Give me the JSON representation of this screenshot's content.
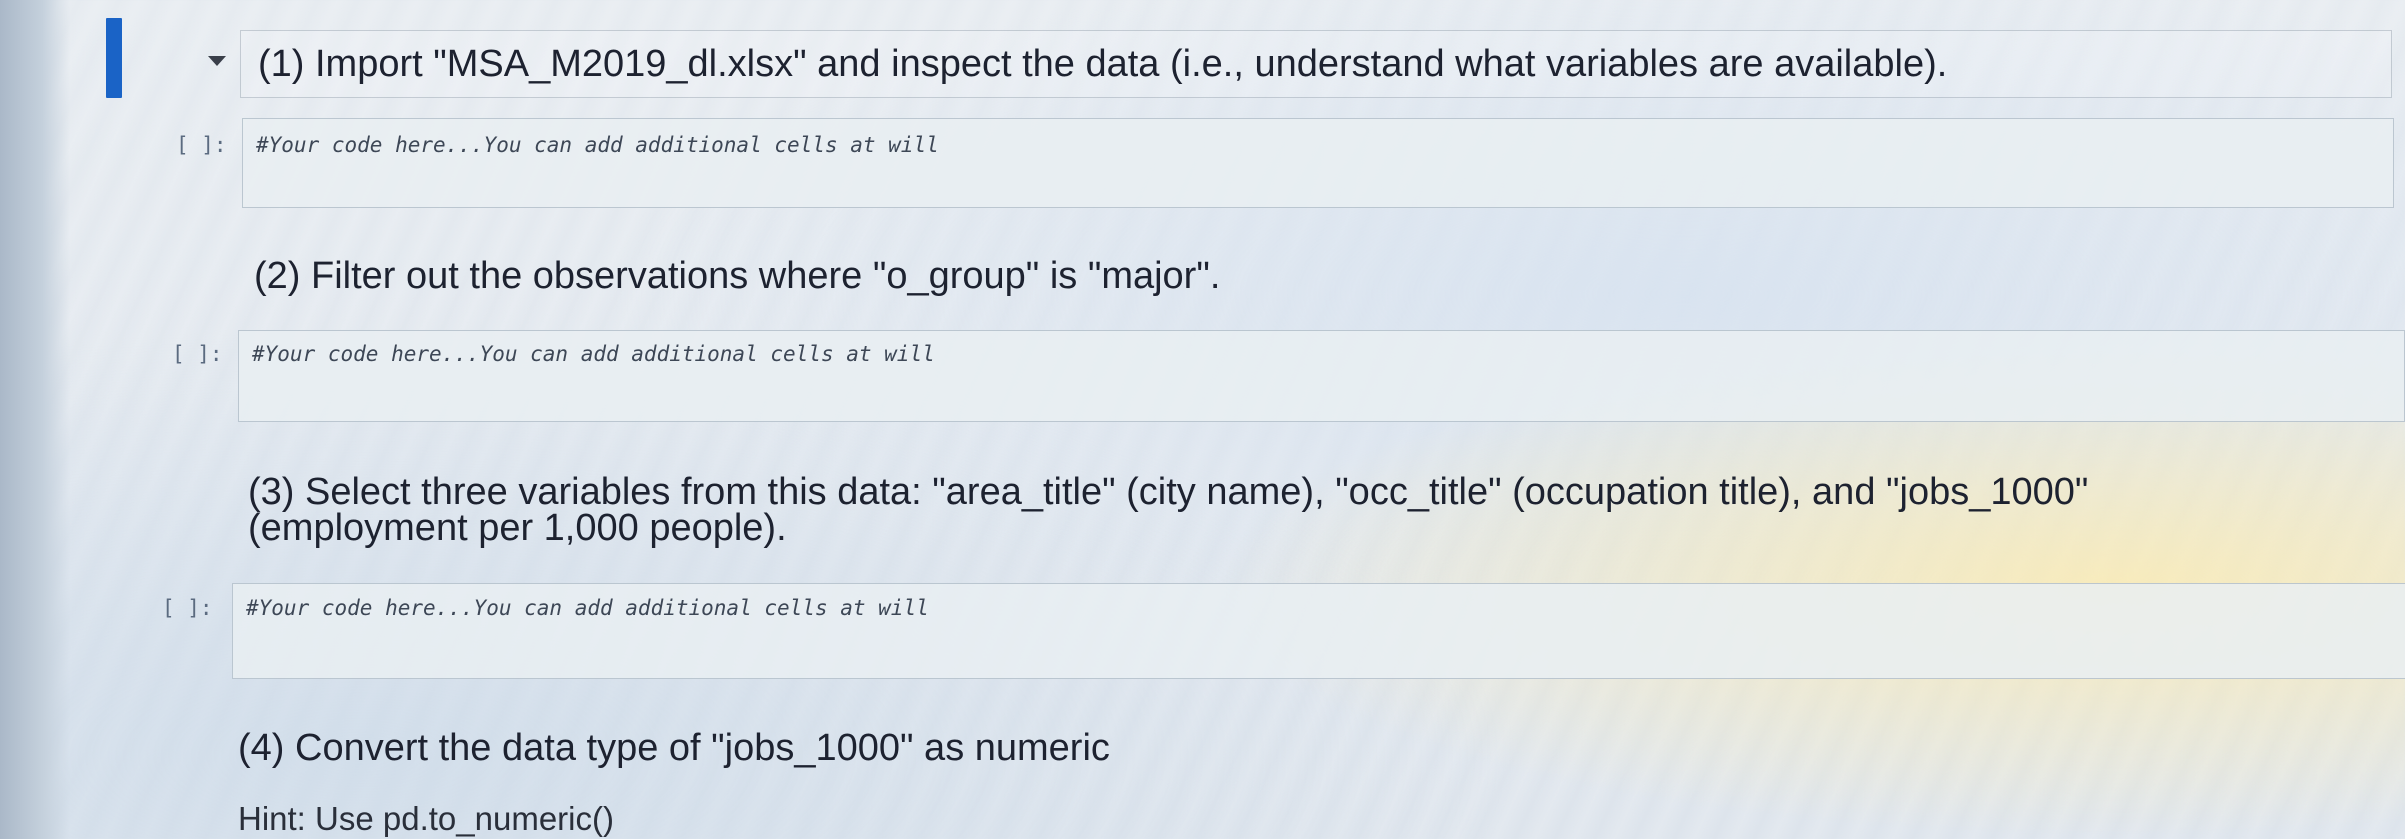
{
  "cells": [
    {
      "kind": "markdown",
      "text": "(1) Import \"MSA_M2019_dl.xlsx\" and inspect the data (i.e., understand what variables are available)."
    },
    {
      "kind": "code",
      "prompt": "[ ]:",
      "code": "#Your code here...You can add additional cells at will"
    },
    {
      "kind": "markdown",
      "text": "(2) Filter out the observations where \"o_group\" is \"major\"."
    },
    {
      "kind": "code",
      "prompt": "[ ]:",
      "code": "#Your code here...You can add additional cells at will"
    },
    {
      "kind": "markdown",
      "text": "(3) Select three variables from this data: \"area_title\" (city name), \"occ_title\" (occupation title), and \"jobs_1000\" (employment per 1,000 people)."
    },
    {
      "kind": "code",
      "prompt": "[ ]:",
      "code": "#Your code here...You can add additional cells at will"
    },
    {
      "kind": "markdown",
      "text": "(4) Convert the data type of \"jobs_1000\" as numeric"
    },
    {
      "kind": "markdown",
      "text": "Hint: Use pd.to_numeric()"
    }
  ],
  "icons": {
    "collapse": "caret-down-icon",
    "selection_indicator": "selected-cell-bar"
  },
  "colors": {
    "selection_bar": "#1a63c6",
    "code_background": "#e9eef2",
    "prompt": "#5b6b80"
  }
}
